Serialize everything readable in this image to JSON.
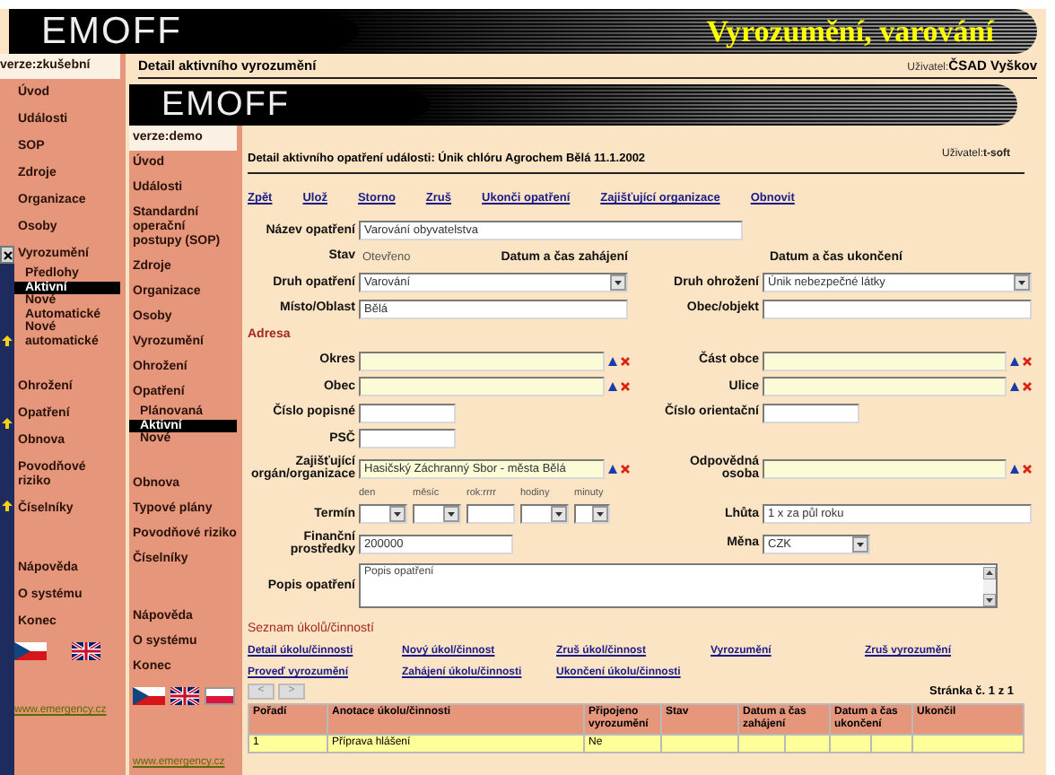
{
  "outer_window": {
    "banner": {
      "logo": "EMOFF",
      "title": "Vyrozumění, varování"
    },
    "heading": "Detail aktivního vyrozumění",
    "user_label": "Uživatel:",
    "user": "ČSAD Vyškov",
    "sidebar": {
      "version": "verze:zkušební",
      "groups": [
        [
          {
            "label": "Úvod",
            "selected": false
          },
          {
            "label": "Události",
            "selected": false
          },
          {
            "label": "SOP",
            "selected": false
          },
          {
            "label": "Zdroje",
            "selected": false
          },
          {
            "label": "Organizace",
            "selected": false
          },
          {
            "label": "Osoby",
            "selected": false
          },
          {
            "label": "Vyrozumění",
            "selected": false,
            "children": [
              {
                "label": "Předlohy",
                "selected": false
              },
              {
                "label": "Aktivní",
                "selected": true
              },
              {
                "label": "Nové Automatické",
                "selected": false
              },
              {
                "label": "Nové automatické",
                "selected": false
              }
            ]
          },
          {
            "label": "Ohrožení",
            "selected": false
          },
          {
            "label": "Opatření",
            "selected": false
          },
          {
            "label": "Obnova",
            "selected": false
          },
          {
            "label": "Povodňové riziko",
            "selected": false
          },
          {
            "label": "Číselníky",
            "selected": false
          }
        ],
        [
          {
            "label": "Nápověda",
            "selected": false
          },
          {
            "label": "O systému",
            "selected": false
          },
          {
            "label": "Konec",
            "selected": false
          }
        ]
      ],
      "flags": [
        {
          "kind": "cz"
        },
        {
          "kind": "uk"
        }
      ],
      "link": "www.emergency.cz"
    }
  },
  "inner_window": {
    "banner": {
      "logo": "EMOFF"
    },
    "heading": "Detail aktivního opatření události: Únik chlóru Agrochem Bělá 11.1.2002",
    "user_label": "Uživatel:",
    "user": "t-soft",
    "sidebar": {
      "version": "verze:demo",
      "groups": [
        [
          {
            "label": "Úvod",
            "selected": false
          },
          {
            "label": "Události",
            "selected": false
          },
          {
            "label": "Standardní operační postupy (SOP)",
            "selected": false
          },
          {
            "label": "Zdroje",
            "selected": false
          },
          {
            "label": "Organizace",
            "selected": false
          },
          {
            "label": "Osoby",
            "selected": false
          },
          {
            "label": "Vyrozumění",
            "selected": false
          },
          {
            "label": "Ohrožení",
            "selected": false
          },
          {
            "label": "Opatření",
            "selected": false,
            "children": [
              {
                "label": "Plánovaná",
                "selected": false
              },
              {
                "label": "Aktivní",
                "selected": true
              },
              {
                "label": "Nové",
                "selected": false
              }
            ]
          },
          {
            "label": "Obnova",
            "selected": false
          },
          {
            "label": "Typové plány",
            "selected": false
          },
          {
            "label": "Povodňové riziko",
            "selected": false
          },
          {
            "label": "Číselníky",
            "selected": false
          }
        ],
        [
          {
            "label": "Nápověda",
            "selected": false
          },
          {
            "label": "O systému",
            "selected": false
          },
          {
            "label": "Konec",
            "selected": false
          }
        ]
      ],
      "flags": [
        {
          "kind": "cz"
        },
        {
          "kind": "uk"
        },
        {
          "kind": "pl"
        }
      ],
      "link": "www.emergency.cz"
    },
    "actions": [
      "Zpět",
      "Ulož",
      "Storno",
      "Zruš",
      "Ukonči opatření",
      "Zajišťující organizace",
      "Obnovit"
    ],
    "form": {
      "rows": [
        {
          "kind": "pair",
          "left": {
            "label": "Název opatření",
            "kind": "long",
            "value": "Varování obyvatelstva"
          }
        },
        {
          "kind": "status",
          "label": "Stav",
          "value": "Otevřeno",
          "start": "Datum a čas zahájení",
          "end": "Datum a čas ukončení"
        },
        {
          "kind": "pair",
          "left": {
            "label": "Druh opatření",
            "kind": "select",
            "value": "Varování"
          },
          "right": {
            "label": "Druh ohrožení",
            "kind": "select",
            "value": "Únik nebezpečné látky"
          }
        },
        {
          "kind": "pair",
          "left": {
            "label": "Místo/Oblast",
            "kind": "text",
            "value": "Bělá"
          },
          "right": {
            "label": "Obec/objekt",
            "kind": "text"
          }
        },
        {
          "kind": "heading",
          "text": "Adresa"
        },
        {
          "kind": "pair",
          "left": {
            "label": "Okres",
            "kind": "lookup"
          },
          "right": {
            "label": "Část obce",
            "kind": "lookup"
          }
        },
        {
          "kind": "pair",
          "left": {
            "label": "Obec",
            "kind": "lookup"
          },
          "right": {
            "label": "Ulice",
            "kind": "lookup"
          }
        },
        {
          "kind": "pair",
          "left": {
            "label": "Číslo popisné",
            "kind": "short"
          },
          "right": {
            "label": "Číslo orientační",
            "kind": "short"
          }
        },
        {
          "kind": "pair",
          "left": {
            "label": "PSČ",
            "kind": "short"
          }
        },
        {
          "kind": "pair",
          "left": {
            "label": "Zajišťující orgán/organizace",
            "kind": "lookup",
            "value": "Hasičský Záchranný Sbor - města Bělá"
          },
          "right": {
            "label": "Odpovědná osoba",
            "kind": "lookup"
          }
        },
        {
          "kind": "termin",
          "label": "Termín",
          "parts": [
            {
              "label": "den",
              "kind": "select"
            },
            {
              "label": "měsíc",
              "kind": "select"
            },
            {
              "label": "rok:rrrr",
              "kind": "text"
            },
            {
              "label": "hodiny",
              "kind": "select"
            },
            {
              "label": "minuty",
              "kind": "select"
            }
          ],
          "right": {
            "label": "Lhůta",
            "kind": "text",
            "value": "1 x za půl roku"
          }
        },
        {
          "kind": "pair",
          "left": {
            "label": "Finanční prostředky",
            "kind": "medium",
            "value": "200000"
          },
          "right": {
            "label": "Měna",
            "kind": "short-select",
            "value": "CZK"
          }
        },
        {
          "kind": "pair",
          "left": {
            "label": "Popis opatření",
            "kind": "textarea",
            "value": "Popis opatření"
          }
        }
      ]
    },
    "tasks": {
      "heading": "Seznam úkolů/činností",
      "links": [
        "Detail úkolu/činnosti",
        "Nový úkol/činnost",
        "Zruš úkol/činnost",
        "Vyrozumění",
        "Zruš vyrozumění",
        "Proveď vyrozumění",
        "Zahájení úkolu/činnosti",
        "Ukončení úkolu/činnosti"
      ],
      "pager": {
        "prev": "<",
        "next": ">",
        "page": "Stránka č. 1 z 1"
      },
      "columns": [
        "Pořadí",
        "Anotace úkolu/činnosti",
        "Připojeno vyrozumění",
        "Stav",
        "Datum a čas zahájení",
        "Datum a čas ukončení",
        "Ukončil"
      ],
      "rows": [
        {
          "order": "1",
          "annotation": "Příprava hlášení",
          "attached": "Ne",
          "selected": true
        }
      ]
    }
  }
}
